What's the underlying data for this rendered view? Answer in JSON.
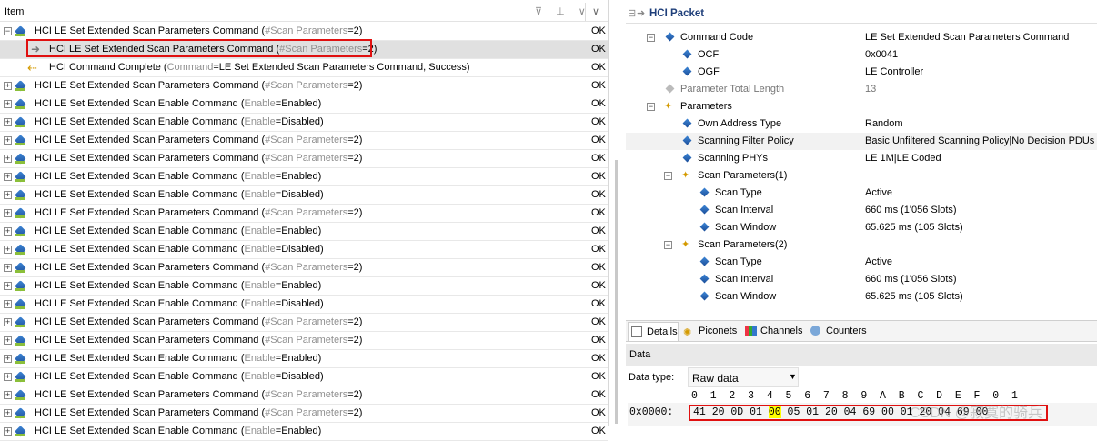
{
  "left": {
    "header": {
      "item": "Item",
      "icons": "⊽ ⊥ ∨",
      "chevron": "∨"
    },
    "rows": [
      {
        "kind": "cmd",
        "exp": "−",
        "name": "HCI LE Set Extended Scan Parameters Command",
        "open": " (",
        "param": "#Scan Parameters",
        "close": "=2)",
        "status": "OK"
      },
      {
        "kind": "arrow",
        "exp": "",
        "name": "HCI LE Set Extended Scan Parameters Command",
        "open": " (",
        "param": "#Scan Parameters",
        "close": "=2)",
        "status": "OK"
      },
      {
        "kind": "evt",
        "exp": "",
        "name": "HCI Command Complete",
        "open": " (",
        "param": "Command",
        "close": "=LE Set Extended Scan Parameters Command, Success)",
        "status": "OK"
      },
      {
        "kind": "cmd",
        "exp": "+",
        "name": "HCI LE Set Extended Scan Parameters Command",
        "open": " (",
        "param": "#Scan Parameters",
        "close": "=2)",
        "status": "OK"
      },
      {
        "kind": "cmd",
        "exp": "+",
        "name": "HCI LE Set Extended Scan Enable Command",
        "open": " (",
        "param": "Enable",
        "close": "=Enabled)",
        "status": "OK"
      },
      {
        "kind": "cmd",
        "exp": "+",
        "name": "HCI LE Set Extended Scan Enable Command",
        "open": " (",
        "param": "Enable",
        "close": "=Disabled)",
        "status": "OK"
      },
      {
        "kind": "cmd",
        "exp": "+",
        "name": "HCI LE Set Extended Scan Parameters Command",
        "open": " (",
        "param": "#Scan Parameters",
        "close": "=2)",
        "status": "OK"
      },
      {
        "kind": "cmd",
        "exp": "+",
        "name": "HCI LE Set Extended Scan Parameters Command",
        "open": " (",
        "param": "#Scan Parameters",
        "close": "=2)",
        "status": "OK"
      },
      {
        "kind": "cmd",
        "exp": "+",
        "name": "HCI LE Set Extended Scan Enable Command",
        "open": " (",
        "param": "Enable",
        "close": "=Enabled)",
        "status": "OK"
      },
      {
        "kind": "cmd",
        "exp": "+",
        "name": "HCI LE Set Extended Scan Enable Command",
        "open": " (",
        "param": "Enable",
        "close": "=Disabled)",
        "status": "OK"
      },
      {
        "kind": "cmd",
        "exp": "+",
        "name": "HCI LE Set Extended Scan Parameters Command",
        "open": " (",
        "param": "#Scan Parameters",
        "close": "=2)",
        "status": "OK"
      },
      {
        "kind": "cmd",
        "exp": "+",
        "name": "HCI LE Set Extended Scan Enable Command",
        "open": " (",
        "param": "Enable",
        "close": "=Enabled)",
        "status": "OK"
      },
      {
        "kind": "cmd",
        "exp": "+",
        "name": "HCI LE Set Extended Scan Enable Command",
        "open": " (",
        "param": "Enable",
        "close": "=Disabled)",
        "status": "OK"
      },
      {
        "kind": "cmd",
        "exp": "+",
        "name": "HCI LE Set Extended Scan Parameters Command",
        "open": " (",
        "param": "#Scan Parameters",
        "close": "=2)",
        "status": "OK"
      },
      {
        "kind": "cmd",
        "exp": "+",
        "name": "HCI LE Set Extended Scan Enable Command",
        "open": " (",
        "param": "Enable",
        "close": "=Enabled)",
        "status": "OK"
      },
      {
        "kind": "cmd",
        "exp": "+",
        "name": "HCI LE Set Extended Scan Enable Command",
        "open": " (",
        "param": "Enable",
        "close": "=Disabled)",
        "status": "OK"
      },
      {
        "kind": "cmd",
        "exp": "+",
        "name": "HCI LE Set Extended Scan Parameters Command",
        "open": " (",
        "param": "#Scan Parameters",
        "close": "=2)",
        "status": "OK"
      },
      {
        "kind": "cmd",
        "exp": "+",
        "name": "HCI LE Set Extended Scan Parameters Command",
        "open": " (",
        "param": "#Scan Parameters",
        "close": "=2)",
        "status": "OK"
      },
      {
        "kind": "cmd",
        "exp": "+",
        "name": "HCI LE Set Extended Scan Enable Command",
        "open": " (",
        "param": "Enable",
        "close": "=Enabled)",
        "status": "OK"
      },
      {
        "kind": "cmd",
        "exp": "+",
        "name": "HCI LE Set Extended Scan Enable Command",
        "open": " (",
        "param": "Enable",
        "close": "=Disabled)",
        "status": "OK"
      },
      {
        "kind": "cmd",
        "exp": "+",
        "name": "HCI LE Set Extended Scan Parameters Command",
        "open": " (",
        "param": "#Scan Parameters",
        "close": "=2)",
        "status": "OK"
      },
      {
        "kind": "cmd",
        "exp": "+",
        "name": "HCI LE Set Extended Scan Parameters Command",
        "open": " (",
        "param": "#Scan Parameters",
        "close": "=2)",
        "status": "OK"
      },
      {
        "kind": "cmd",
        "exp": "+",
        "name": "HCI LE Set Extended Scan Enable Command",
        "open": " (",
        "param": "Enable",
        "close": "=Enabled)",
        "status": "OK"
      }
    ]
  },
  "right": {
    "title": "HCI Packet",
    "tree": [
      {
        "lvl": 1,
        "tog": "−",
        "icon": "dia",
        "label": "Command Code",
        "value": ""
      },
      {
        "lvl": 2,
        "tog": "",
        "icon": "dia",
        "label": "OCF",
        "value": "0x0041"
      },
      {
        "lvl": 2,
        "tog": "",
        "icon": "dia",
        "label": "OGF",
        "value": "LE Controller"
      },
      {
        "lvl": 1,
        "tog": "",
        "icon": "grey",
        "label": "Parameter Total Length",
        "value": "13",
        "grey": true
      },
      {
        "lvl": 1,
        "tog": "−",
        "icon": "gear",
        "label": "Parameters",
        "value": ""
      },
      {
        "lvl": 2,
        "tog": "",
        "icon": "dia",
        "label": "Own Address Type",
        "value": "Random"
      },
      {
        "lvl": 2,
        "tog": "",
        "icon": "dia",
        "label": "Scanning Filter Policy",
        "value": "Basic Unfiltered Scanning Policy|No Decision PDUs",
        "alt": true
      },
      {
        "lvl": 2,
        "tog": "",
        "icon": "dia",
        "label": "Scanning PHYs",
        "value": "LE 1M|LE Coded"
      },
      {
        "lvl": 2,
        "tog": "−",
        "icon": "gear",
        "label": "Scan Parameters(1)",
        "value": ""
      },
      {
        "lvl": 3,
        "tog": "",
        "icon": "dia",
        "label": "Scan Type",
        "value": "Active"
      },
      {
        "lvl": 3,
        "tog": "",
        "icon": "dia",
        "label": "Scan Interval",
        "value": "660 ms (1'056 Slots)"
      },
      {
        "lvl": 3,
        "tog": "",
        "icon": "dia",
        "label": "Scan Window",
        "value": "65.625 ms (105 Slots)"
      },
      {
        "lvl": 2,
        "tog": "−",
        "icon": "gear",
        "label": "Scan Parameters(2)",
        "value": ""
      },
      {
        "lvl": 3,
        "tog": "",
        "icon": "dia",
        "label": "Scan Type",
        "value": "Active"
      },
      {
        "lvl": 3,
        "tog": "",
        "icon": "dia",
        "label": "Scan Interval",
        "value": "660 ms (1'056 Slots)"
      },
      {
        "lvl": 3,
        "tog": "",
        "icon": "dia",
        "label": "Scan Window",
        "value": "65.625 ms (105 Slots)"
      }
    ],
    "command_code_value": "LE Set Extended Scan Parameters Command",
    "tabs": [
      "Details",
      "Piconets",
      "Channels",
      "Counters"
    ],
    "data_header": "Data",
    "data_type_label": "Data type:",
    "data_type_value": "Raw data",
    "hex_header": "0  1  2  3  4  5  6  7  8  9  A  B  C  D  E  F  0  1",
    "hex_address": "0x0000:",
    "hex_bytes_pre": "41 20 0D 01 ",
    "hex_bytes_hl": "00",
    "hex_bytes_post": " 05 01 20 04 69 00 01 20 04 69 00",
    "watermark": "CSDN @寂寞的骑兵"
  }
}
